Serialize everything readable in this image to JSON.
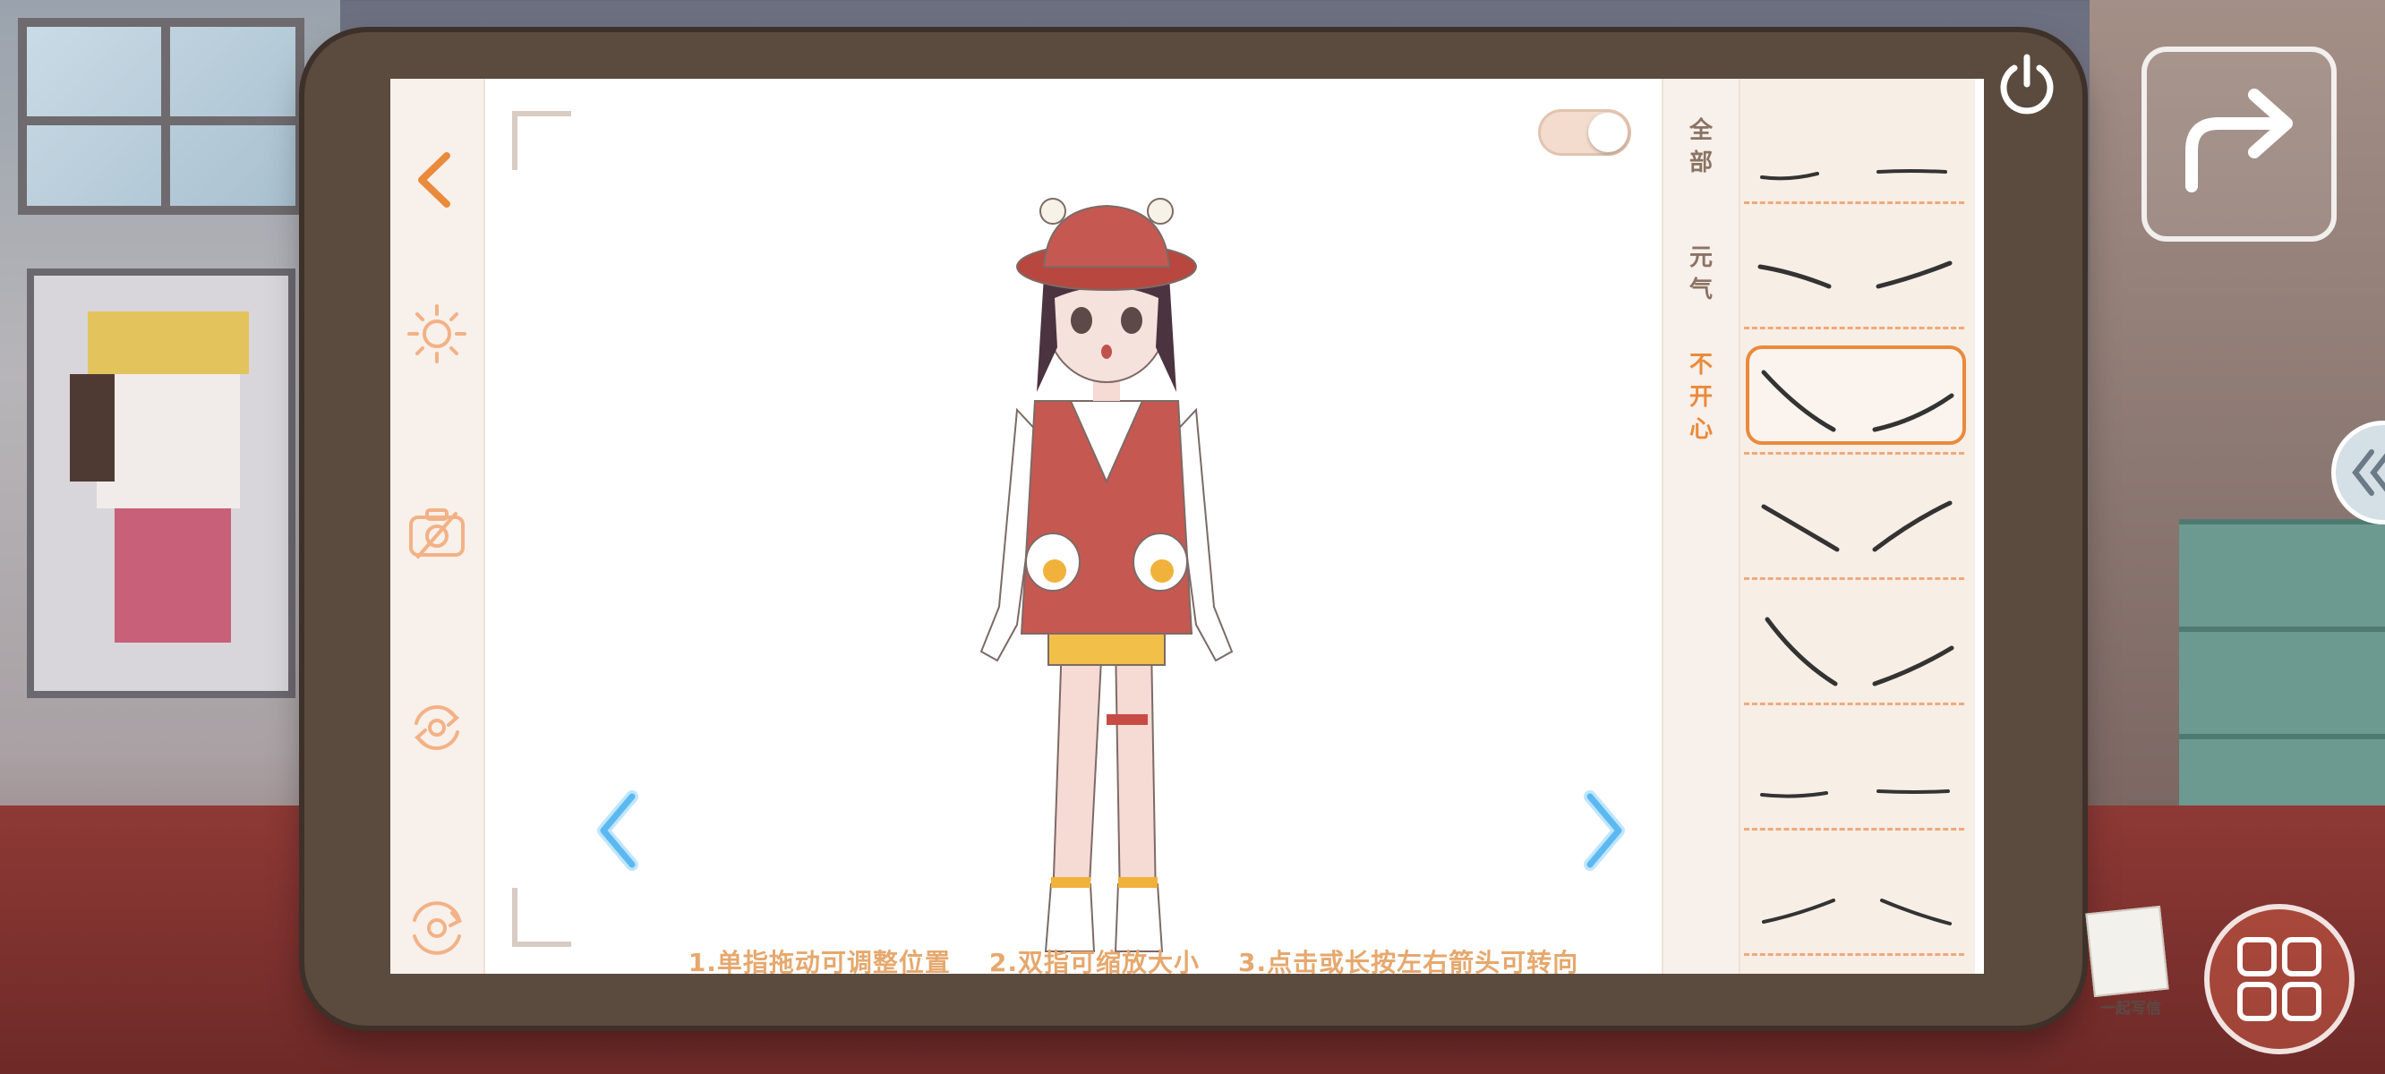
{
  "left_rail": {
    "buttons": [
      {
        "name": "back",
        "icon": "chevron-left-icon"
      },
      {
        "name": "lighting",
        "icon": "sun-icon"
      },
      {
        "name": "hide-camera",
        "icon": "camera-off-icon"
      },
      {
        "name": "rotate",
        "icon": "rotate-icon"
      },
      {
        "name": "reset-rotation",
        "icon": "rotate-reset-icon"
      }
    ]
  },
  "categories": [
    {
      "label": "全部",
      "chars": [
        "全",
        "部"
      ],
      "active": false
    },
    {
      "label": "元气",
      "chars": [
        "元",
        "气"
      ],
      "active": false
    },
    {
      "label": "不开心",
      "chars": [
        "不",
        "开",
        "心"
      ],
      "active": true
    }
  ],
  "eyebrow_options": [
    {
      "id": 1,
      "selected": false
    },
    {
      "id": 2,
      "selected": false
    },
    {
      "id": 3,
      "selected": true
    },
    {
      "id": 4,
      "selected": false
    },
    {
      "id": 5,
      "selected": false
    },
    {
      "id": 6,
      "selected": false
    },
    {
      "id": 7,
      "selected": false
    }
  ],
  "instructions": "1.单指拖动可调整位置    2.双指可缩放大小    3.点击或长按左右箭头可转向",
  "toggle": {
    "on": true
  },
  "letter_button": {
    "label": "一起写信"
  },
  "colors": {
    "accent": "#ea8a3b",
    "arrow_blue": "#5cb8f0",
    "tablet_frame": "#5b4a3e"
  }
}
